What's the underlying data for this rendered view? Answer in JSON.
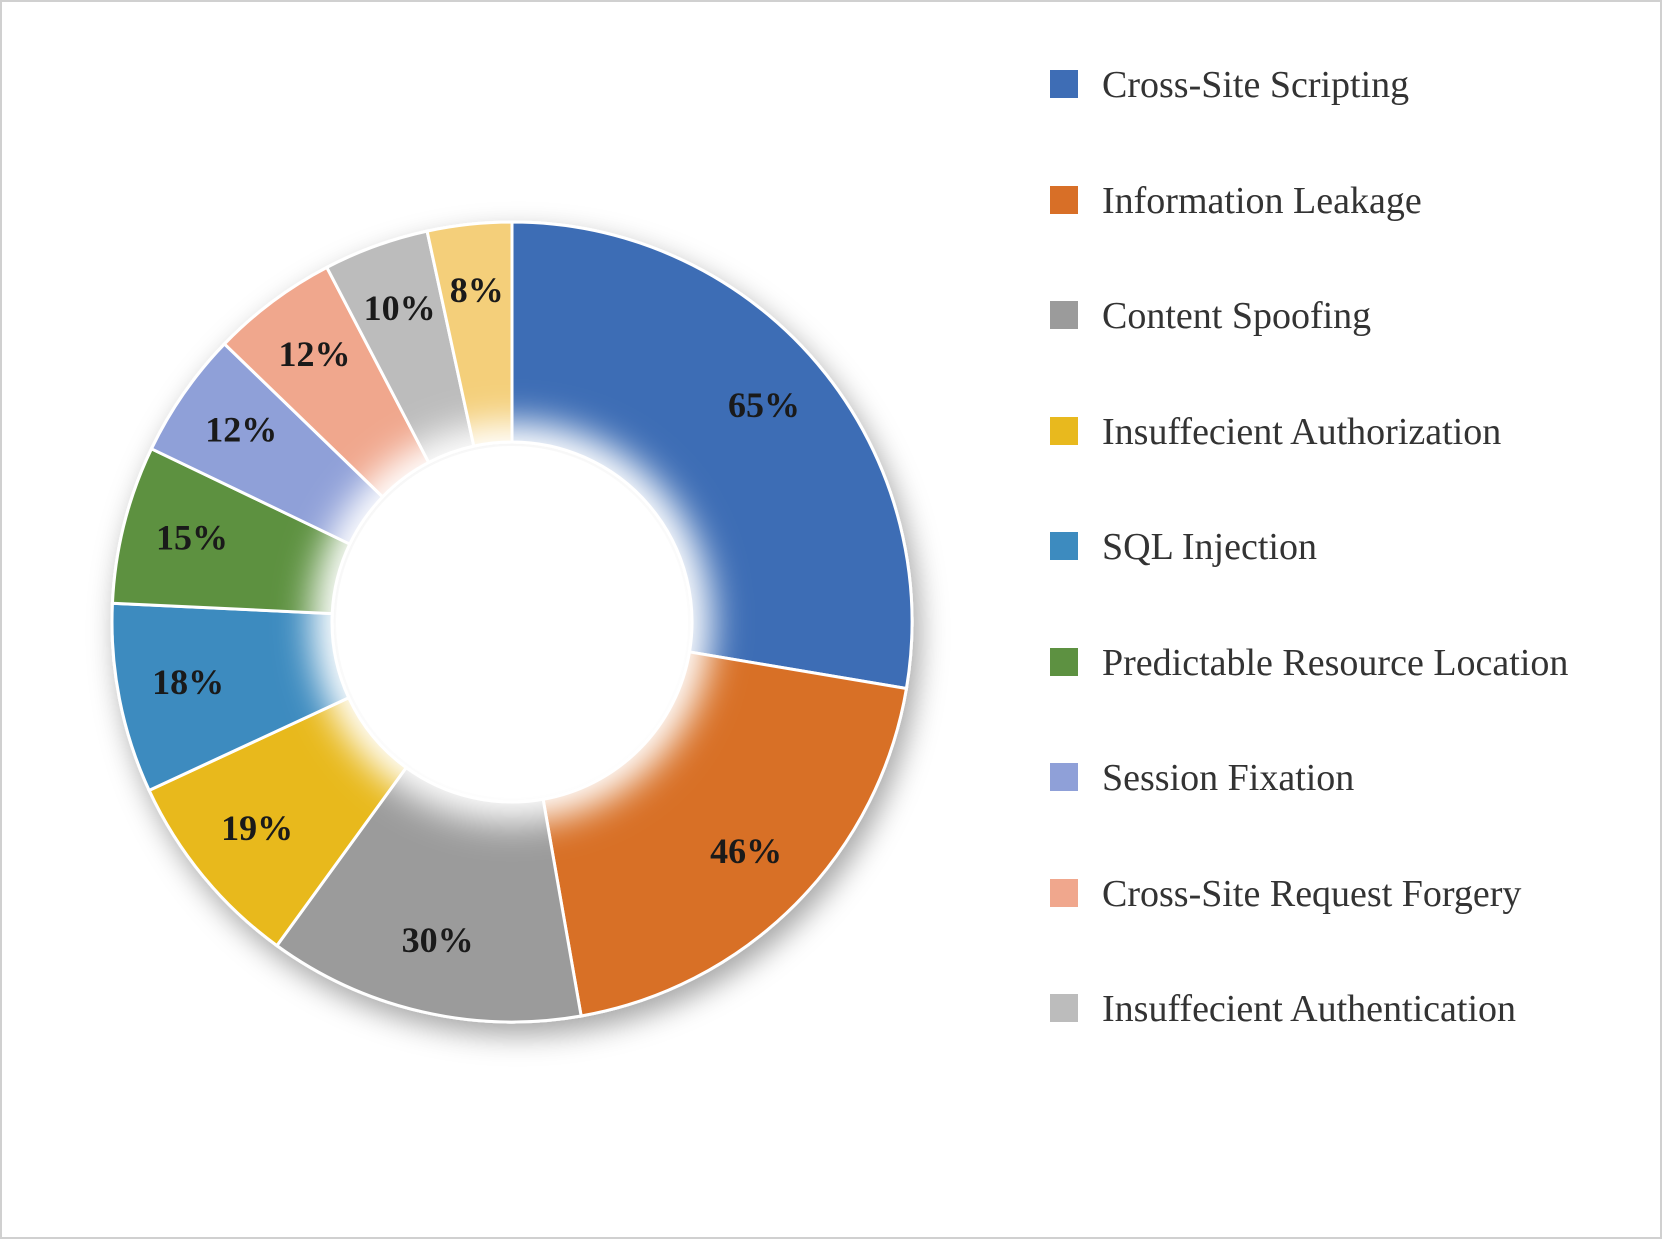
{
  "chart_data": {
    "type": "pie",
    "donut": true,
    "title": "",
    "legend_position": "right",
    "series": [
      {
        "name": "Cross-Site Scripting",
        "value": 65,
        "label": "65%",
        "color": "#3e6db5"
      },
      {
        "name": "Information Leakage",
        "value": 46,
        "label": "46%",
        "color": "#d86f27"
      },
      {
        "name": "Content Spoofing",
        "value": 30,
        "label": "30%",
        "color": "#9b9b9b"
      },
      {
        "name": "Insuffecient Authorization",
        "value": 19,
        "label": "19%",
        "color": "#e8b91e"
      },
      {
        "name": "SQL Injection",
        "value": 18,
        "label": "18%",
        "color": "#3d8bbf"
      },
      {
        "name": "Predictable Resource Location",
        "value": 15,
        "label": "15%",
        "color": "#5d9141"
      },
      {
        "name": "Session Fixation",
        "value": 12,
        "label": "12%",
        "color": "#8fa0d8"
      },
      {
        "name": "Cross-Site Request Forgery",
        "value": 12,
        "label": "12%",
        "color": "#f0a78d"
      },
      {
        "name": "Insuffecient Authentication",
        "value": 10,
        "label": "10%",
        "color": "#bcbcbc"
      },
      {
        "name": "",
        "value": 8,
        "label": "8%",
        "color": "#f4cf7a"
      }
    ]
  }
}
